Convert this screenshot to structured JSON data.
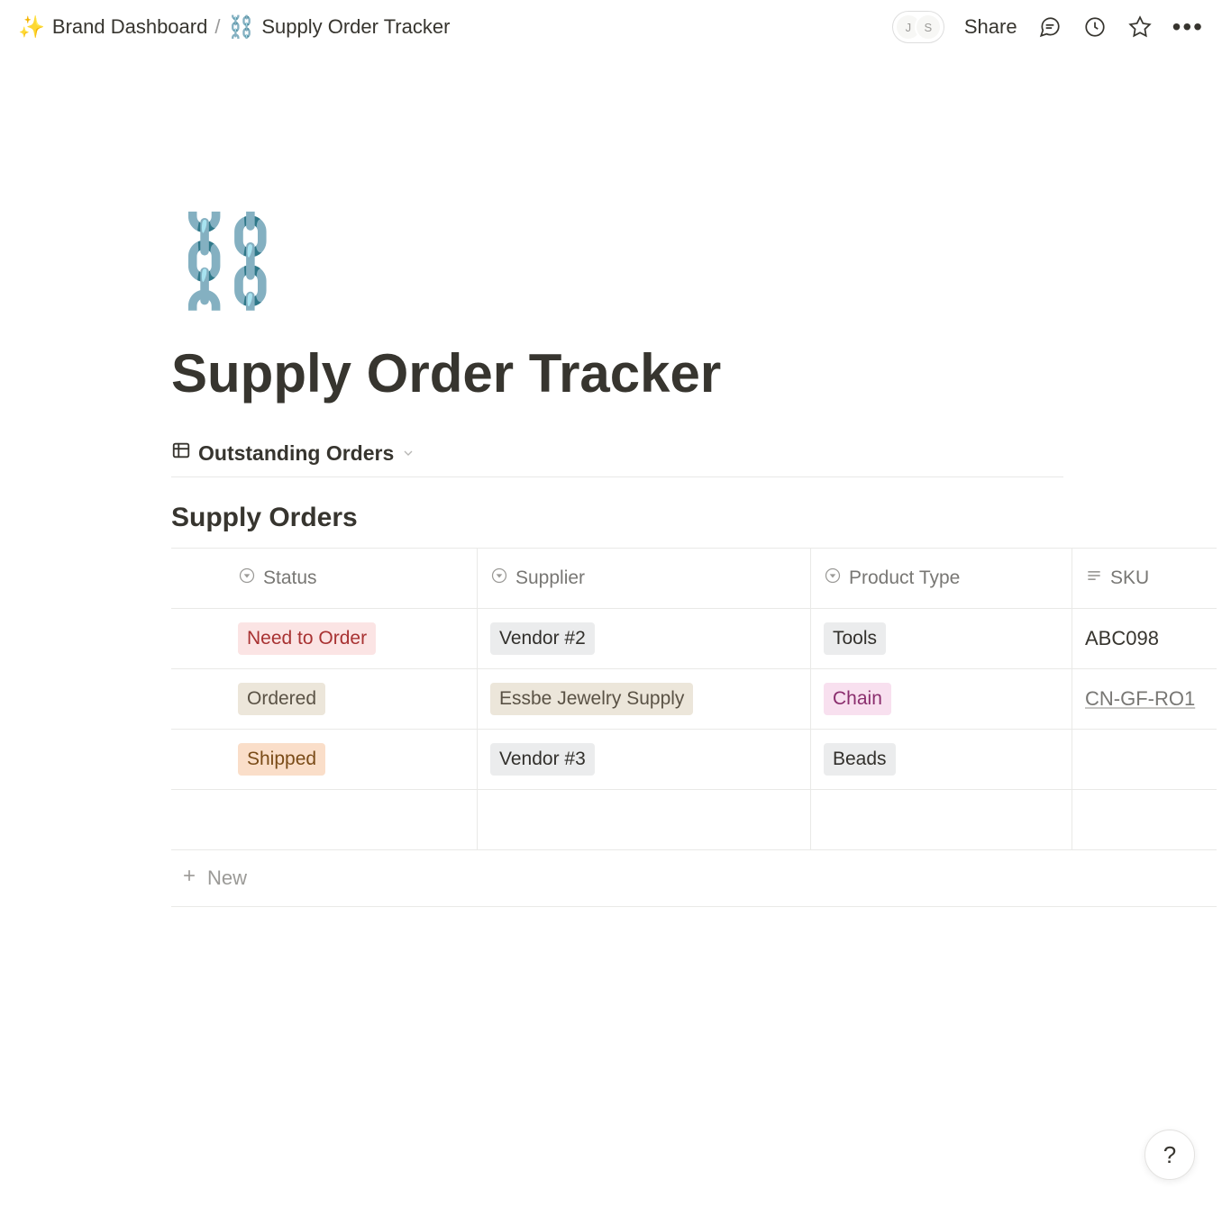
{
  "breadcrumb": {
    "parent_icon": "✨",
    "parent_label": "Brand Dashboard",
    "sep": "/",
    "page_icon": "⛓️",
    "page_label": "Supply Order Tracker"
  },
  "topbar": {
    "presence": [
      "J",
      "S"
    ],
    "share_label": "Share"
  },
  "page": {
    "emoji": "⛓️",
    "title": "Supply Order Tracker"
  },
  "view": {
    "active_label": "Outstanding Orders"
  },
  "database": {
    "title": "Supply Orders",
    "columns": {
      "status": "Status",
      "supplier": "Supplier",
      "product_type": "Product Type",
      "sku": "SKU"
    },
    "rows": [
      {
        "status": {
          "text": "Need to Order",
          "color": "red"
        },
        "supplier": {
          "text": "Vendor #2",
          "color": "gray"
        },
        "product_type": {
          "text": "Tools",
          "color": "gray"
        },
        "sku": "ABC098",
        "sku_style": "plain"
      },
      {
        "status": {
          "text": "Ordered",
          "color": "beige"
        },
        "supplier": {
          "text": "Essbe Jewelry Supply",
          "color": "beige"
        },
        "product_type": {
          "text": "Chain",
          "color": "pink"
        },
        "sku": "CN-GF-RO1",
        "sku_style": "link"
      },
      {
        "status": {
          "text": "Shipped",
          "color": "orange"
        },
        "supplier": {
          "text": "Vendor #3",
          "color": "gray"
        },
        "product_type": {
          "text": "Beads",
          "color": "gray"
        },
        "sku": "",
        "sku_style": "plain"
      }
    ],
    "new_label": "New"
  },
  "help": {
    "label": "?"
  }
}
